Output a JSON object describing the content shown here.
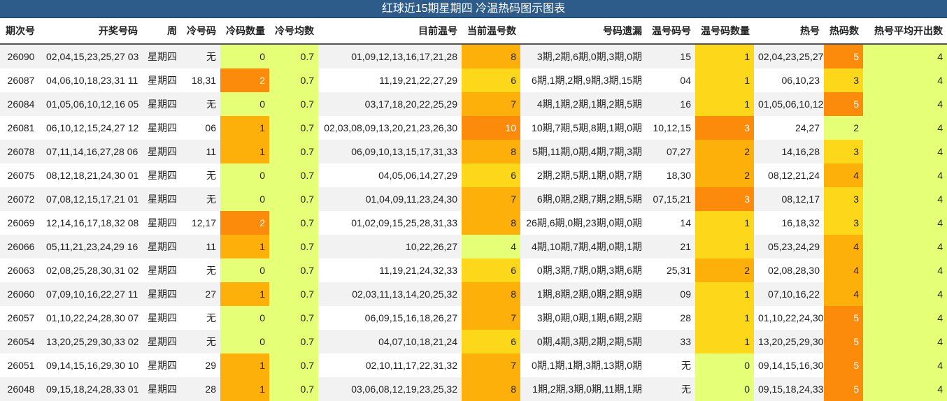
{
  "title": "红球近15期星期四 冷温热码图示图表",
  "headers": [
    "期次号",
    "开奖号码",
    "周",
    "冷号码",
    "冷码数量",
    "冷号均数",
    "目前温号",
    "当前温号数",
    "号码遗漏",
    "温号码号",
    "温号码数量",
    "热号",
    "热码数",
    "热号平均开出数"
  ],
  "rows": [
    {
      "issue": "26090",
      "numbers": "02,04,15,23,25,27 03",
      "week": "星期四",
      "cold": "无",
      "cold_count": "0",
      "cold_avg": "0.7",
      "cur_warm": "01,09,12,13,16,17,21,28",
      "cur_warm_count": "8",
      "miss": "3期,2期,6期,0期,3期,0期",
      "warm": "15",
      "warm_count": "1",
      "hot": "02,04,23,25,27",
      "hot_count": "5",
      "hot_avg": "4"
    },
    {
      "issue": "26087",
      "numbers": "04,06,10,18,23,31 11",
      "week": "星期四",
      "cold": "18,31",
      "cold_count": "2",
      "cold_avg": "0.7",
      "cur_warm": "11,19,21,22,27,29",
      "cur_warm_count": "6",
      "miss": "6期,1期,2期,9期,3期,15期",
      "warm": "04",
      "warm_count": "1",
      "hot": "06,10,23",
      "hot_count": "3",
      "hot_avg": "4"
    },
    {
      "issue": "26084",
      "numbers": "01,05,06,10,12,16 05",
      "week": "星期四",
      "cold": "无",
      "cold_count": "0",
      "cold_avg": "0.7",
      "cur_warm": "03,17,18,20,22,25,29",
      "cur_warm_count": "7",
      "miss": "4期,1期,2期,1期,2期,5期",
      "warm": "16",
      "warm_count": "1",
      "hot": "01,05,06,10,12",
      "hot_count": "5",
      "hot_avg": "4"
    },
    {
      "issue": "26081",
      "numbers": "06,10,12,15,24,27 12",
      "week": "星期四",
      "cold": "06",
      "cold_count": "1",
      "cold_avg": "0.7",
      "cur_warm": "02,03,08,09,13,20,21,23,26,30",
      "cur_warm_count": "10",
      "miss": "10期,7期,5期,8期,1期,0期",
      "warm": "10,12,15",
      "warm_count": "3",
      "hot": "24,27",
      "hot_count": "2",
      "hot_avg": "4"
    },
    {
      "issue": "26078",
      "numbers": "07,11,14,16,27,28 06",
      "week": "星期四",
      "cold": "11",
      "cold_count": "1",
      "cold_avg": "0.7",
      "cur_warm": "06,09,10,13,15,17,31,33",
      "cur_warm_count": "8",
      "miss": "5期,11期,0期,4期,7期,3期",
      "warm": "07,27",
      "warm_count": "2",
      "hot": "14,16,28",
      "hot_count": "3",
      "hot_avg": "4"
    },
    {
      "issue": "26075",
      "numbers": "08,12,18,21,24,30 01",
      "week": "星期四",
      "cold": "无",
      "cold_count": "0",
      "cold_avg": "0.7",
      "cur_warm": "04,05,06,14,27,29",
      "cur_warm_count": "6",
      "miss": "2期,2期,5期,1期,0期,7期",
      "warm": "18,30",
      "warm_count": "2",
      "hot": "08,12,21,24",
      "hot_count": "4",
      "hot_avg": "4"
    },
    {
      "issue": "26072",
      "numbers": "07,08,12,15,17,21 01",
      "week": "星期四",
      "cold": "无",
      "cold_count": "0",
      "cold_avg": "0.7",
      "cur_warm": "01,04,09,11,23,24,30",
      "cur_warm_count": "7",
      "miss": "6期,0期,2期,7期,2期,5期",
      "warm": "07,15,21",
      "warm_count": "3",
      "hot": "08,12,17",
      "hot_count": "3",
      "hot_avg": "4"
    },
    {
      "issue": "26069",
      "numbers": "12,14,16,17,18,32 08",
      "week": "星期四",
      "cold": "12,17",
      "cold_count": "2",
      "cold_avg": "0.7",
      "cur_warm": "01,02,09,15,25,28,31,33",
      "cur_warm_count": "8",
      "miss": "26期,6期,0期,23期,0期,0期",
      "warm": "14",
      "warm_count": "1",
      "hot": "16,18,32",
      "hot_count": "3",
      "hot_avg": "4"
    },
    {
      "issue": "26066",
      "numbers": "05,11,21,23,24,29 16",
      "week": "星期四",
      "cold": "11",
      "cold_count": "1",
      "cold_avg": "0.7",
      "cur_warm": "10,22,26,27",
      "cur_warm_count": "4",
      "miss": "4期,10期,7期,4期,0期,1期",
      "warm": "21",
      "warm_count": "1",
      "hot": "05,23,24,29",
      "hot_count": "4",
      "hot_avg": "4"
    },
    {
      "issue": "26063",
      "numbers": "02,08,25,28,30,31 02",
      "week": "星期四",
      "cold": "无",
      "cold_count": "0",
      "cold_avg": "0.7",
      "cur_warm": "11,19,21,24,32,33",
      "cur_warm_count": "6",
      "miss": "0期,3期,7期,0期,3期,6期",
      "warm": "25,31",
      "warm_count": "2",
      "hot": "02,08,28,30",
      "hot_count": "4",
      "hot_avg": "4"
    },
    {
      "issue": "26060",
      "numbers": "07,09,10,16,22,27 11",
      "week": "星期四",
      "cold": "27",
      "cold_count": "1",
      "cold_avg": "0.7",
      "cur_warm": "02,03,11,13,14,20,25,32",
      "cur_warm_count": "8",
      "miss": "1期,8期,2期,0期,2期,9期",
      "warm": "09",
      "warm_count": "1",
      "hot": "07,10,16,22",
      "hot_count": "4",
      "hot_avg": "4"
    },
    {
      "issue": "26057",
      "numbers": "01,10,22,24,28,30 07",
      "week": "星期四",
      "cold": "无",
      "cold_count": "0",
      "cold_avg": "0.7",
      "cur_warm": "06,09,15,16,18,26,27",
      "cur_warm_count": "7",
      "miss": "3期,0期,0期,1期,6期,2期",
      "warm": "28",
      "warm_count": "1",
      "hot": "01,10,22,24,30",
      "hot_count": "5",
      "hot_avg": "4"
    },
    {
      "issue": "26054",
      "numbers": "13,20,25,29,30,33 02",
      "week": "星期四",
      "cold": "无",
      "cold_count": "0",
      "cold_avg": "0.7",
      "cur_warm": "04,07,10,18,21,24",
      "cur_warm_count": "6",
      "miss": "0期,4期,3期,2期,2期,5期",
      "warm": "33",
      "warm_count": "1",
      "hot": "13,20,25,29,30",
      "hot_count": "5",
      "hot_avg": "4"
    },
    {
      "issue": "26051",
      "numbers": "09,14,15,16,29,30 10",
      "week": "星期四",
      "cold": "29",
      "cold_count": "1",
      "cold_avg": "0.7",
      "cur_warm": "02,10,11,17,22,31,32",
      "cur_warm_count": "7",
      "miss": "0期,1期,1期,3期,13期,0期",
      "warm": "无",
      "warm_count": "0",
      "hot": "09,14,15,16,30",
      "hot_count": "5",
      "hot_avg": "4"
    },
    {
      "issue": "26048",
      "numbers": "09,15,18,24,28,33 01",
      "week": "星期四",
      "cold": "28",
      "cold_count": "1",
      "cold_avg": "0.7",
      "cur_warm": "03,06,08,12,19,23,25,32",
      "cur_warm_count": "8",
      "miss": "1期,2期,3期,0期,11期,1期",
      "warm": "无",
      "warm_count": "0",
      "hot": "09,15,18,24,33",
      "hot_count": "5",
      "hot_avg": "4"
    }
  ],
  "colors": {
    "title_bg": "#2e5c8a",
    "lime": "#e5ff76",
    "yellow": "#fdd81a",
    "amber": "#fdb00a",
    "orange": "#fd8b0b"
  }
}
